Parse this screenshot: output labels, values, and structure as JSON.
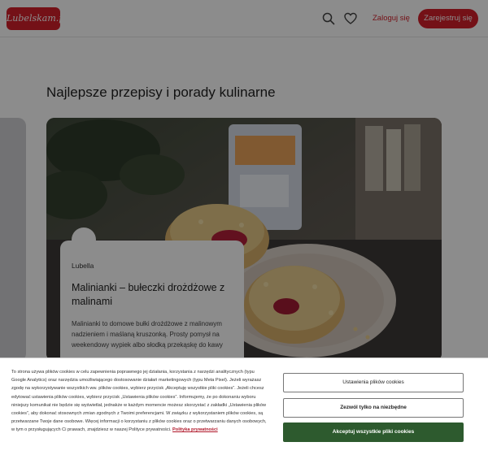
{
  "header": {
    "logo_text": "Lubelskam.pl",
    "search_icon": "search-icon",
    "favorites_icon": "heart-icon",
    "login_label": "Zaloguj się",
    "register_label": "Zarejestruj się",
    "brand_color": "#d41f2a"
  },
  "main": {
    "section_title": "Najlepsze przepisy i porady kulinarne",
    "featured": {
      "brand": "Lubella",
      "title": "Malinianki – bułeczki drożdżowe z malinami",
      "description": "Malinianki to domowe bułki drożdżowe z malinowym nadzieniem i maślaną kruszonką. Prosty pomysł na weekendowy wypiek albo słodką przekąskę do kawy"
    }
  },
  "cookie_banner": {
    "text": "To strona używa plików cookies w celu zapewnienia poprawnego jej działania, korzystania z narzędzi analitycznych (typu Google Analytics) oraz narzędzia umożliwiającego dostosowanie działań marketingowych (typu Meta Pixel). Jeżeli wyrażasz zgodę na wykorzystywanie wszystkich ww. plików cookies, wybierz przycisk „Akceptuję wszystkie pliki cookies”. Jeżeli chcesz edytować ustawienia plików cookies, wybierz przycisk „Ustawienia plików cookies”. Informujemy, że po dokonaniu wyboru niniejszy komunikat nie będzie się wyświetlał, jednakże w każdym momencie możesz skorzystać z zakładki „Ustawienia plików cookies”, aby dokonać stosownych zmian zgodnych z Twoimi preferencjami. W związku z wykorzystaniem plików cookies, są przetwarzane Twoje dane osobowe. Więcej informacji o korzystaniu z plików cookies oraz o przetwarzaniu danych osobowych, w tym o przysługujących Ci prawach, znajdziesz w naszej Polityce prywatności.",
    "privacy_link": "Polityka prywatności",
    "settings_label": "Ustawienia plików cookies",
    "necessary_label": "Zezwól tylko na niezbędne",
    "accept_label": "Akceptuj wszystkie pliki cookies",
    "accept_color": "#2d5a2e"
  }
}
